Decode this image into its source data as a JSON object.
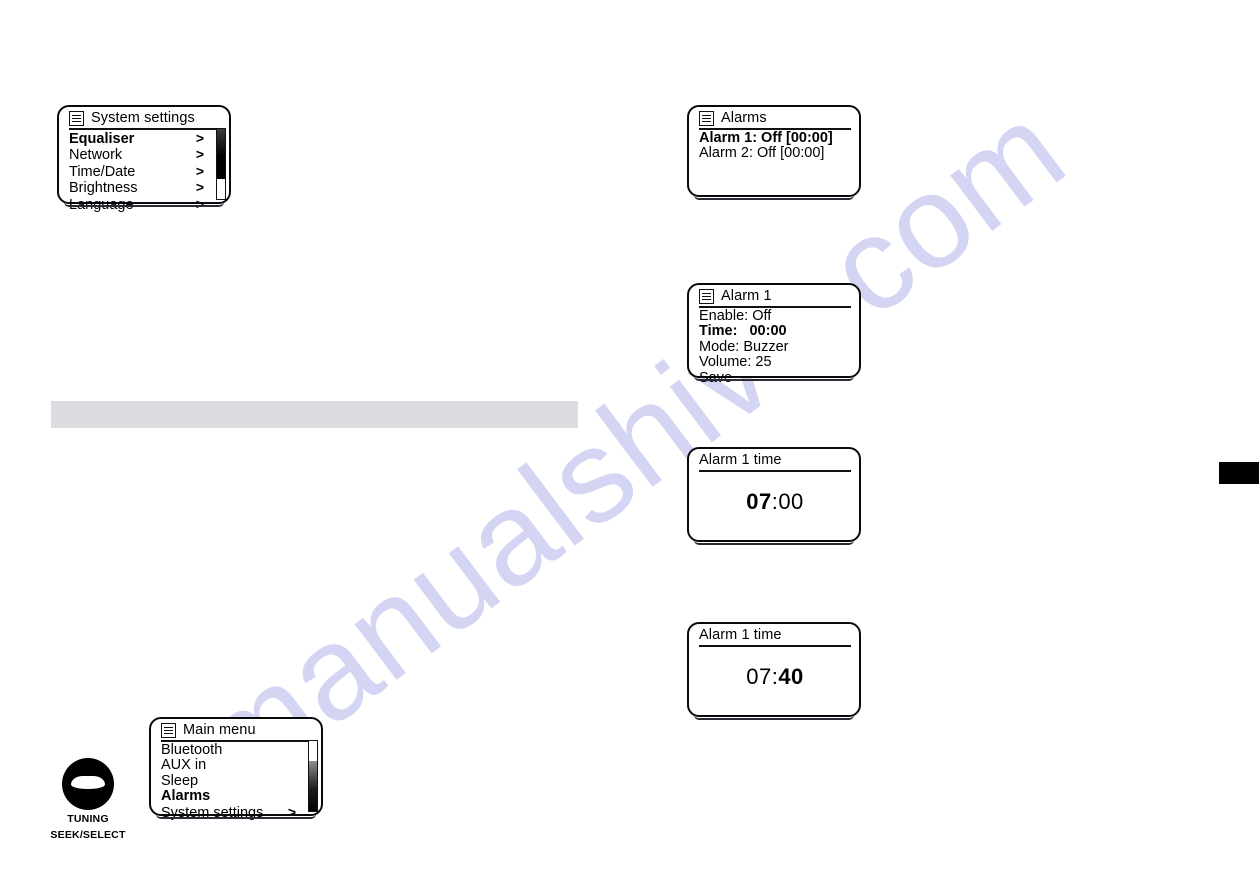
{
  "page": {
    "watermark": "manualshive.com",
    "gray_bar_color": "#dcdde0",
    "edge_tab_color": "#000000"
  },
  "control": {
    "name": "tuning-knob",
    "label_line1": "TUNING",
    "label_line2": "SEEK/SELECT"
  },
  "displays": {
    "system_settings": {
      "icon": "menu-icon",
      "title": "System settings",
      "items": [
        {
          "label": "Equaliser",
          "chevron": ">",
          "selected": true
        },
        {
          "label": "Network",
          "chevron": ">",
          "selected": false
        },
        {
          "label": "Time/Date",
          "chevron": ">",
          "selected": false
        },
        {
          "label": "Brightness",
          "chevron": ">",
          "selected": false
        },
        {
          "label": "Language",
          "chevron": ">",
          "selected": false
        }
      ],
      "scrollbar": {
        "position": "top",
        "thumb_percent": 72
      }
    },
    "main_menu": {
      "icon": "menu-icon",
      "title": "Main menu",
      "items": [
        {
          "label": "Bluetooth",
          "chevron": "",
          "selected": false
        },
        {
          "label": "AUX in",
          "chevron": "",
          "selected": false
        },
        {
          "label": "Sleep",
          "chevron": "",
          "selected": false
        },
        {
          "label": "Alarms",
          "chevron": "",
          "selected": true
        },
        {
          "label": "System settings",
          "chevron": ">",
          "selected": false
        }
      ],
      "scrollbar": {
        "position": "bottom",
        "thumb_percent": 72
      }
    },
    "alarms": {
      "icon": "menu-icon",
      "title": "Alarms",
      "items": [
        {
          "label": "Alarm 1: Off [00:00]",
          "chevron": "",
          "selected": true
        },
        {
          "label": "Alarm 2: Off [00:00]",
          "chevron": "",
          "selected": false
        }
      ]
    },
    "alarm_1": {
      "icon": "menu-icon",
      "title": "Alarm 1",
      "items": [
        {
          "label": "Enable: Off",
          "chevron": "",
          "selected": false
        },
        {
          "label": "Time:   00:00",
          "chevron": "",
          "selected": true
        },
        {
          "label": "Mode: Buzzer",
          "chevron": "",
          "selected": false
        },
        {
          "label": "Volume: 25",
          "chevron": "",
          "selected": false
        },
        {
          "label": "Save",
          "chevron": "",
          "selected": false
        }
      ]
    },
    "alarm_1_time_hour": {
      "title": "Alarm 1 time",
      "time_bold": "07",
      "time_sep": ":",
      "time_plain": "00",
      "bold_part": "hour"
    },
    "alarm_1_time_minute": {
      "title": "Alarm 1 time",
      "time_plain": "07",
      "time_sep": ":",
      "time_bold": "40",
      "bold_part": "minute"
    }
  }
}
